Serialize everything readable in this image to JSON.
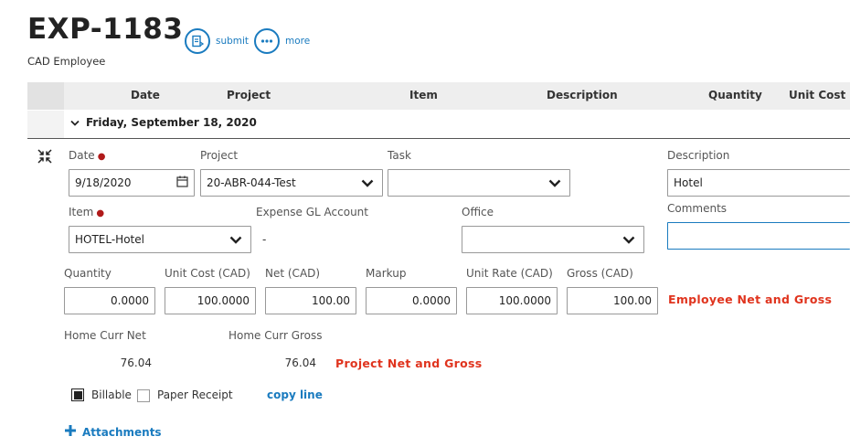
{
  "header": {
    "title": "EXP-1183",
    "subtitle": "CAD Employee",
    "submit_label": "submit",
    "more_label": "more"
  },
  "columns": [
    "Date",
    "Project",
    "Item",
    "Description",
    "Quantity",
    "Unit Cost"
  ],
  "group": {
    "label": "Friday, September 18, 2020"
  },
  "form": {
    "date": {
      "label": "Date",
      "value": "9/18/2020"
    },
    "project": {
      "label": "Project",
      "value": "20-ABR-044-Test"
    },
    "task": {
      "label": "Task",
      "value": ""
    },
    "description": {
      "label": "Description",
      "value": "Hotel"
    },
    "item": {
      "label": "Item",
      "value": "HOTEL-Hotel"
    },
    "expense_gl": {
      "label": "Expense GL Account",
      "value": "-"
    },
    "office": {
      "label": "Office",
      "value": ""
    },
    "comments": {
      "label": "Comments",
      "value": ""
    },
    "quantity": {
      "label": "Quantity",
      "value": "0.0000"
    },
    "unit_cost": {
      "label": "Unit Cost (CAD)",
      "value": "100.0000"
    },
    "net": {
      "label": "Net (CAD)",
      "value": "100.00"
    },
    "markup": {
      "label": "Markup",
      "value": "0.0000"
    },
    "unit_rate": {
      "label": "Unit Rate (CAD)",
      "value": "100.0000"
    },
    "gross": {
      "label": "Gross (CAD)",
      "value": "100.00"
    },
    "employee_annotation": "Employee Net and Gross",
    "home_net": {
      "label": "Home Curr Net",
      "value": "76.04"
    },
    "home_gross": {
      "label": "Home Curr Gross",
      "value": "76.04"
    },
    "project_annotation": "Project Net and Gross",
    "billable": {
      "label": "Billable",
      "checked": true
    },
    "paper_receipt": {
      "label": "Paper Receipt",
      "checked": false
    },
    "copy_line_label": "copy line",
    "attachments_label": "Attachments"
  },
  "colors": {
    "accent": "#1a7bbf",
    "annotation": "#e0341e",
    "required": "#b01a1a"
  }
}
